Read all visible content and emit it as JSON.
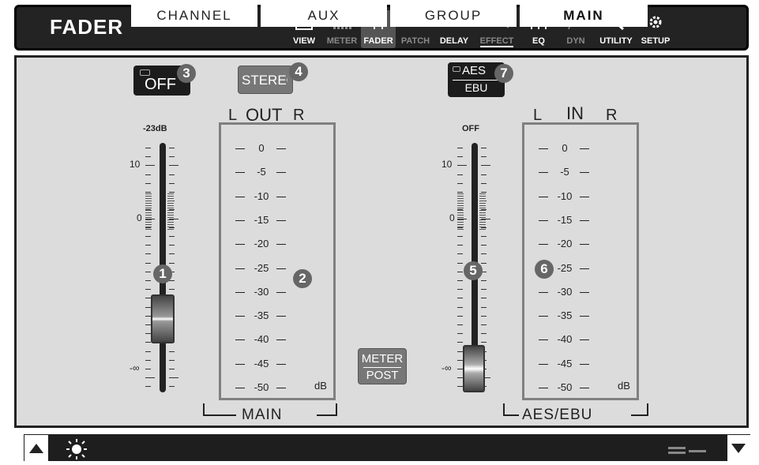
{
  "header": {
    "title": "FADER"
  },
  "toolbar": [
    {
      "label": "VIEW",
      "icon": "view-icon",
      "state": "normal"
    },
    {
      "label": "METER",
      "icon": "meter-icon",
      "state": "dim"
    },
    {
      "label": "FADER",
      "icon": "fader-icon",
      "state": "active"
    },
    {
      "label": "PATCH",
      "icon": "patch-icon",
      "state": "dim"
    },
    {
      "label": "DELAY",
      "icon": "delay-icon",
      "state": "normal"
    },
    {
      "label": "EFFECT",
      "icon": "effect-icon",
      "state": "underline"
    },
    {
      "label": "EQ",
      "icon": "eq-icon",
      "state": "normal"
    },
    {
      "label": "DYN",
      "icon": "dyn-icon",
      "state": "dim"
    },
    {
      "label": "UTILITY",
      "icon": "utility-icon",
      "state": "normal"
    },
    {
      "label": "SETUP",
      "icon": "setup-icon",
      "state": "normal"
    }
  ],
  "out_section": {
    "off_button": "OFF",
    "stereo_button": "STEREO",
    "fader_top": "-23dB",
    "fader_marks": {
      "ten": "10",
      "zero": "0",
      "inf": "-∞"
    },
    "meter": {
      "left": "L",
      "title": "OUT",
      "right": "R",
      "scale": [
        "0",
        "-5",
        "-10",
        "-15",
        "-20",
        "-25",
        "-30",
        "-35",
        "-40",
        "-45",
        "-50"
      ],
      "unit": "dB"
    },
    "bus_label": "MAIN"
  },
  "in_section": {
    "aes_button": {
      "line1": "AES",
      "line2": "EBU"
    },
    "fader_top": "OFF",
    "fader_marks": {
      "ten": "10",
      "zero": "0",
      "inf": "-∞"
    },
    "meter": {
      "left": "L",
      "title": "IN",
      "right": "R",
      "scale": [
        "0",
        "-5",
        "-10",
        "-15",
        "-20",
        "-25",
        "-30",
        "-35",
        "-40",
        "-45",
        "-50"
      ],
      "unit": "dB"
    },
    "bus_label": "AES/EBU"
  },
  "meter_post_button": {
    "line1": "METER",
    "line2": "POST"
  },
  "badges": [
    "1",
    "2",
    "3",
    "4",
    "5",
    "6",
    "7"
  ],
  "bottom_tabs": [
    {
      "label": "CHANNEL",
      "active": false
    },
    {
      "label": "AUX",
      "active": false
    },
    {
      "label": "GROUP",
      "active": false
    },
    {
      "label": "MAIN",
      "active": true
    }
  ],
  "colors": {
    "header_bg": "#232323",
    "panel_bg": "#dcdcdc",
    "meter_border": "#808080",
    "badge": "#666666"
  }
}
